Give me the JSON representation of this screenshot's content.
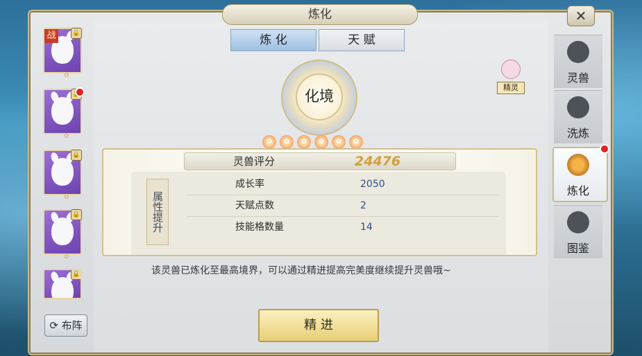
{
  "window": {
    "title": "炼化",
    "close_label": "✕"
  },
  "pets": [
    {
      "badge": "战",
      "lock": true,
      "dot": false
    },
    {
      "badge": "",
      "lock": true,
      "dot": true
    },
    {
      "badge": "",
      "lock": true,
      "dot": false
    },
    {
      "badge": "",
      "lock": true,
      "dot": false
    },
    {
      "badge": "",
      "lock": true,
      "dot": false
    }
  ],
  "buzhen": {
    "label": "布阵"
  },
  "tabs": [
    {
      "label": "炼 化",
      "active": true
    },
    {
      "label": "天 赋",
      "active": false
    }
  ],
  "emblem": {
    "label": "化境"
  },
  "fairy": {
    "label": "精灵"
  },
  "star_count": 6,
  "score": {
    "label": "灵兽评分",
    "value": "24476"
  },
  "attr_section": {
    "title": "属性提升"
  },
  "attrs": [
    {
      "key": "成长率",
      "value": "2050"
    },
    {
      "key": "天赋点数",
      "value": "2"
    },
    {
      "key": "技能格数量",
      "value": "14"
    }
  ],
  "note": "该灵兽已炼化至最高境界，可以通过精进提高完美度继续提升灵兽哦~",
  "action": {
    "label": "精 进"
  },
  "right_tabs": [
    {
      "label": "灵兽",
      "icon": "beast-icon",
      "active": false
    },
    {
      "label": "洗炼",
      "icon": "cauldron-icon",
      "active": false
    },
    {
      "label": "炼化",
      "icon": "flame-icon",
      "active": true,
      "dot": true
    },
    {
      "label": "图鉴",
      "icon": "book-icon",
      "active": false
    }
  ]
}
